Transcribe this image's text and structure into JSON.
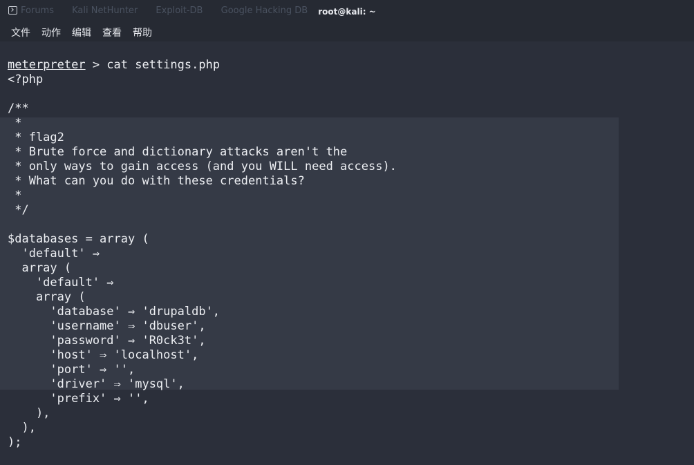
{
  "window": {
    "title": "root@kali: ~",
    "background_tabs": [
      "Forums",
      "Kali NetHunter",
      "Exploit-DB",
      "Google Hacking DB"
    ]
  },
  "menu": [
    "文件",
    "动作",
    "编辑",
    "查看",
    "帮助"
  ],
  "terminal": {
    "prompt": "meterpreter",
    "command": " > cat settings.php",
    "output_lines": [
      "<?php",
      "",
      "/**",
      " *",
      " * flag2",
      " * Brute force and dictionary attacks aren't the",
      " * only ways to gain access (and you WILL need access).",
      " * What can you do with these credentials?",
      " *",
      " */",
      "",
      "$databases = array (",
      "  'default' ⇒",
      "  array (",
      "    'default' ⇒",
      "    array (",
      "      'database' ⇒ 'drupaldb',",
      "      'username' ⇒ 'dbuser',",
      "      'password' ⇒ 'R0ck3t',",
      "      'host' ⇒ 'localhost',",
      "      'port' ⇒ '',",
      "      'driver' ⇒ 'mysql',",
      "      'prefix' ⇒ '',",
      "    ),",
      "  ),",
      ");"
    ]
  },
  "colors": {
    "background": "#2b2f3a",
    "titlebar": "#262a33",
    "text": "#eceef2"
  }
}
